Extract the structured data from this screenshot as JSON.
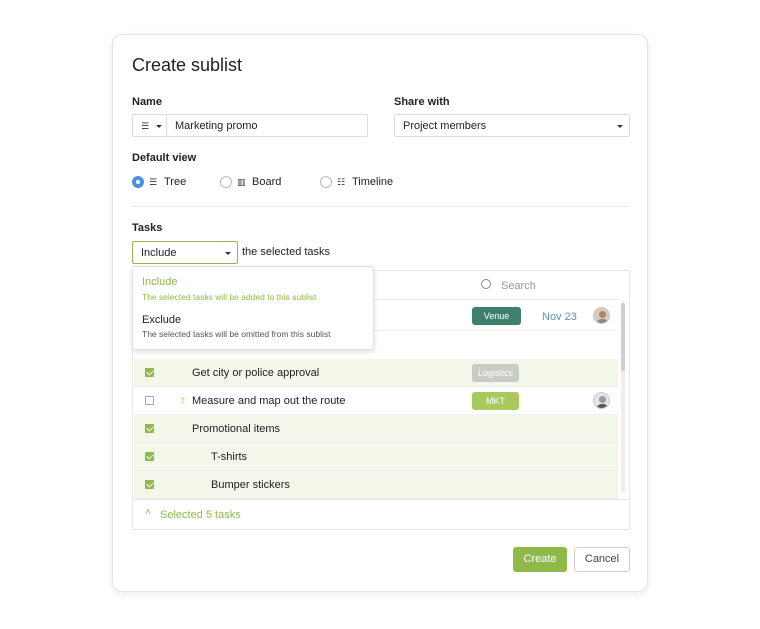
{
  "dialog": {
    "title": "Create sublist",
    "name_label": "Name",
    "name_value": "Marketing promo",
    "share_label": "Share with",
    "share_value": "Project members",
    "default_view_label": "Default view",
    "views": [
      {
        "label": "Tree",
        "selected": true,
        "icon": "tree-view-icon"
      },
      {
        "label": "Board",
        "selected": false,
        "icon": "board-view-icon"
      },
      {
        "label": "Timeline",
        "selected": false,
        "icon": "timeline-view-icon"
      }
    ],
    "tasks_label": "Tasks",
    "mode_value": "Include",
    "mode_suffix": "the selected tasks",
    "search_placeholder": "Search",
    "dropdown": [
      {
        "title": "Include",
        "desc": "The selected tasks will be added to this sublist",
        "active": true
      },
      {
        "title": "Exclude",
        "desc": "The selected tasks will be omitted from this sublist",
        "active": false
      }
    ],
    "rows": [
      {
        "name": "",
        "tag": "Venue",
        "date": "Nov 23",
        "checked": false
      },
      {
        "name": "Get city or police approval",
        "tag": "Logistics",
        "checked": true
      },
      {
        "name": "Measure and map out the route",
        "tag": "MKT",
        "checked": false
      },
      {
        "name": "Promotional items",
        "checked": true
      },
      {
        "name": "T-shirts",
        "checked": true
      },
      {
        "name": "Bumper stickers",
        "checked": true
      }
    ],
    "selected_summary": "Selected 5 tasks",
    "create_label": "Create",
    "cancel_label": "Cancel"
  },
  "colors": {
    "accent_green": "#8fba4a",
    "venue_tag": "#3e7f6f",
    "logistics_tag": "#c7cdc4",
    "mkt_tag": "#a9c95c",
    "date_color": "#5a9aa0",
    "radio_blue": "#4a90e2"
  }
}
